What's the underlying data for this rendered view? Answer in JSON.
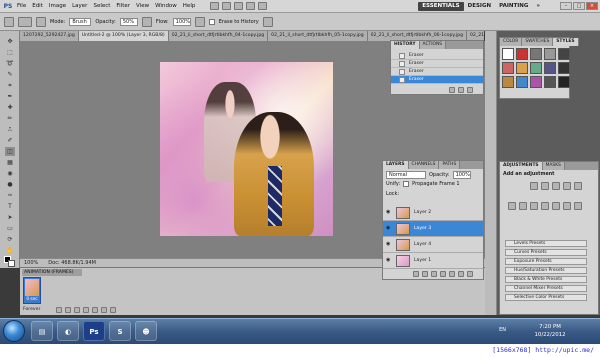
{
  "app": {
    "logo": "PS"
  },
  "menu": [
    "File",
    "Edit",
    "Image",
    "Layer",
    "Select",
    "Filter",
    "View",
    "Window",
    "Help"
  ],
  "workspace": {
    "essentials": "ESSENTIALS",
    "design": "DESIGN",
    "painting": "PAINTING",
    "more": "»"
  },
  "options": {
    "mode_label": "Mode:",
    "mode_value": "Brush",
    "opacity_label": "Opacity:",
    "opacity_value": "50%",
    "flow_label": "Flow:",
    "flow_value": "100%",
    "erase_history": "Erase to History"
  },
  "doc_tabs": [
    "1207292_5292427.jpg",
    "Untitled-2 @ 100% (Layer 3, RGB/8)",
    "02_21_li_short_dtfjrtlbkhfh_04-1copy.jpg",
    "02_21_li_short_dtfjrtlbkhfh_05-1copy.jpg",
    "02_21_li_short_dtfjrtlbkhfh_06-1copy.jpg",
    "02_21_li_short_dtfjrtlbkhfh_01-1copy.jpg"
  ],
  "status": {
    "zoom": "100%",
    "doc": "Doc: 468.8K/1.94M"
  },
  "animation": {
    "title": "ANIMATION (FRAMES)",
    "frame_time": "0 sec",
    "loop": "Forever"
  },
  "history": {
    "tabs": [
      "HISTORY",
      "ACTIONS"
    ],
    "items": [
      "Eraser",
      "Eraser",
      "Eraser",
      "Eraser"
    ],
    "selected_index": 3
  },
  "layers": {
    "tabs": [
      "LAYERS",
      "CHANNELS",
      "PATHS"
    ],
    "blend": "Normal",
    "opacity_label": "Opacity:",
    "opacity_value": "100%",
    "unify_label": "Unify:",
    "propagate": "Propagate Frame 1",
    "lock_label": "Lock:",
    "items": [
      "Layer 2",
      "Layer 3",
      "Layer 4",
      "Layer 1"
    ],
    "selected_index": 1
  },
  "color_panel": {
    "tabs": [
      "COLOR",
      "SWATCHES",
      "STYLES"
    ]
  },
  "adjustments": {
    "tabs": [
      "ADJUSTMENTS",
      "MASKS"
    ],
    "title": "Add an adjustment",
    "presets": [
      "Levels Presets",
      "Curves Presets",
      "Exposure Presets",
      "Hue/Saturation Presets",
      "Black & White Presets",
      "Channel Mixer Presets",
      "Selective Color Presets"
    ]
  },
  "taskbar": {
    "lang": "EN",
    "time": "7:20 PM",
    "date": "10/22/2012"
  },
  "watermark": "[1566x768] http://upic.me/"
}
